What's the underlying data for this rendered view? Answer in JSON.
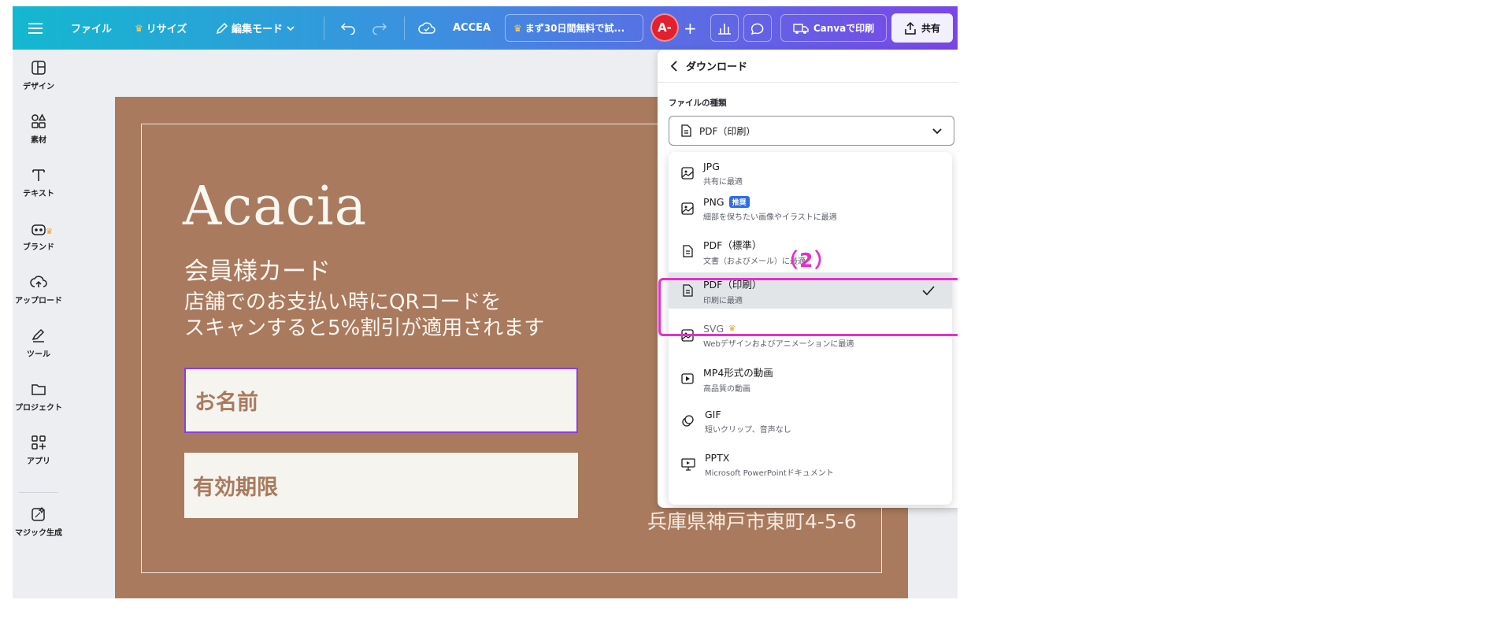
{
  "topbar": {
    "menu": "ファイル",
    "resize": "リサイズ",
    "edit_mode": "編集モード",
    "user_name": "ACCEA",
    "trial": "まず30日間無料で試...",
    "avatar": "A-",
    "print": "Canvaで印刷",
    "share": "共有"
  },
  "sidebar": {
    "items": [
      {
        "label": "デザイン",
        "icon": "design-icon"
      },
      {
        "label": "素材",
        "icon": "elements-icon"
      },
      {
        "label": "テキスト",
        "icon": "text-icon"
      },
      {
        "label": "ブランド",
        "icon": "brand-icon"
      },
      {
        "label": "アップロード",
        "icon": "upload-icon"
      },
      {
        "label": "ツール",
        "icon": "tool-icon"
      },
      {
        "label": "プロジェクト",
        "icon": "folder-icon"
      },
      {
        "label": "アプリ",
        "icon": "apps-icon"
      },
      {
        "label": "マジック生成",
        "icon": "magic-icon"
      }
    ]
  },
  "card": {
    "brand": "Acacia",
    "subtitle": "会員様カード",
    "desc_line1": "店舗でのお支払い時にQRコードを",
    "desc_line2": "スキャンすると5%割引が適用されます",
    "name_label": "お名前",
    "expiry_label": "有効期限",
    "address": "兵庫県神戸市東町4-5-6"
  },
  "download": {
    "title": "ダウンロード",
    "filetype_label": "ファイルの種類",
    "selected": "PDF（印刷）",
    "options": [
      {
        "title": "JPG",
        "desc": "共有に最適",
        "icon": "image-icon"
      },
      {
        "title": "PNG",
        "badge": "推奨",
        "desc": "細部を保ちたい画像やイラストに最適",
        "icon": "image-icon"
      },
      {
        "title": "PDF（標準）",
        "desc": "文書（およびメール）に最適",
        "icon": "document-icon"
      },
      {
        "title": "PDF（印刷）",
        "desc": "印刷に最適",
        "icon": "document-icon",
        "selected": true
      },
      {
        "title": "SVG",
        "desc": "Webデザインおよびアニメーションに最適",
        "icon": "image-icon",
        "premium": true
      },
      {
        "title": "MP4形式の動画",
        "desc": "高品質の動画",
        "icon": "video-icon"
      },
      {
        "title": "GIF",
        "desc": "短いクリップ、音声なし",
        "icon": "gif-icon"
      },
      {
        "title": "PPTX",
        "desc": "Microsoft PowerPointドキュメント",
        "icon": "presentation-icon"
      }
    ]
  },
  "annotation": {
    "label": "（2）",
    "color": "#e52ec9"
  },
  "colors": {
    "canvas": "#a97a5e",
    "accent": "#8b3fe0",
    "selected_row": "#e2e5e8"
  }
}
